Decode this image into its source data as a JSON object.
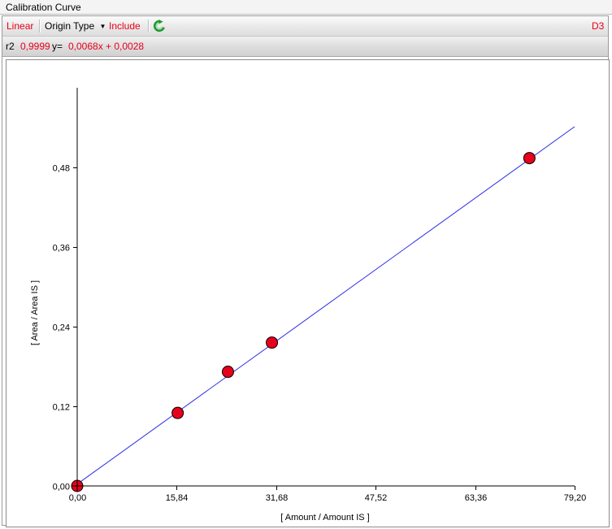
{
  "window": {
    "title": "Calibration Curve"
  },
  "toolbar": {
    "fit_type": "Linear",
    "origin_type": "Origin Type",
    "include": "Include",
    "compound": "D3"
  },
  "stats": {
    "r2_label": "r2",
    "r2_value": "0,9999",
    "eq_label": "y=",
    "equation": "0,0068x + 0,0028"
  },
  "colors": {
    "accent": "#e8001c",
    "line": "#2b2be8",
    "point": "#e8001c",
    "refresh_icon": "#1c9a2a"
  },
  "chart_data": {
    "type": "scatter",
    "title": "",
    "xlabel": "[ Amount / Amount IS ]",
    "ylabel": "[ Area / Area IS ]",
    "xlim": [
      0,
      79.2
    ],
    "ylim": [
      0,
      0.6
    ],
    "x_ticks": [
      0,
      15.84,
      31.68,
      47.52,
      63.36,
      79.2
    ],
    "x_tick_labels": [
      "0,00",
      "15,84",
      "31,68",
      "47,52",
      "63,36",
      "79,20"
    ],
    "y_ticks": [
      0,
      0.12,
      0.24,
      0.36,
      0.48
    ],
    "y_tick_labels": [
      "0,00",
      "0,12",
      "0,24",
      "0,36",
      "0,48"
    ],
    "grid": false,
    "points": [
      {
        "x": 0,
        "y": 0
      },
      {
        "x": 16.0,
        "y": 0.11
      },
      {
        "x": 24.0,
        "y": 0.172
      },
      {
        "x": 31.0,
        "y": 0.216
      },
      {
        "x": 72.0,
        "y": 0.494
      }
    ],
    "fit": {
      "slope": 0.0068,
      "intercept": 0.0028,
      "x_from": 0,
      "x_to": 79.2
    }
  }
}
